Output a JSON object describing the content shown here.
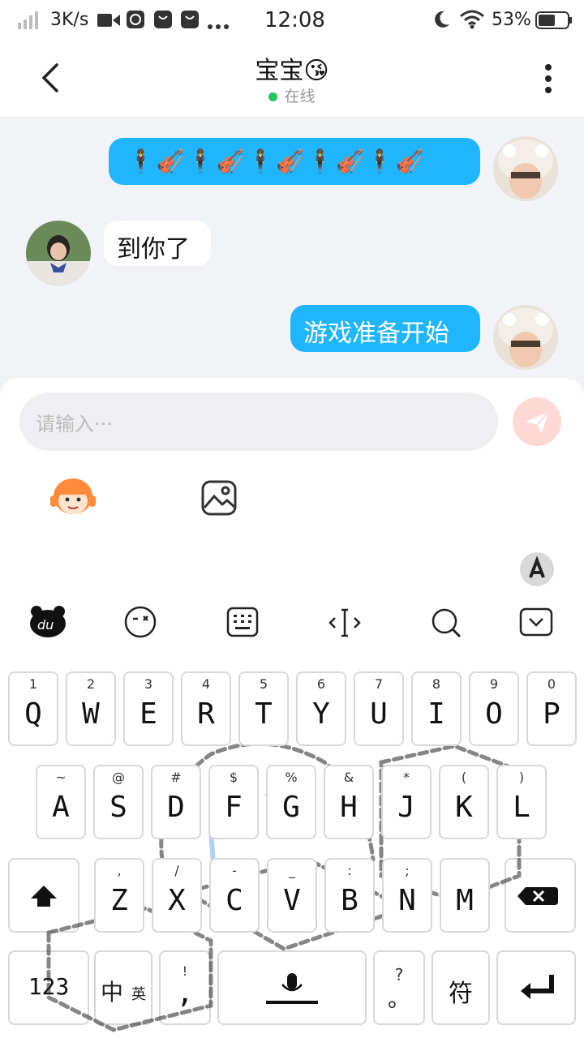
{
  "status_bar": {
    "network_speed": "3K/s",
    "time": "12:08",
    "battery": "53%"
  },
  "header": {
    "title": "宝宝😘",
    "status": "在线"
  },
  "messages": [
    {
      "from": "me",
      "text": "🕴🎻🕴🎻🕴🎻🕴🎻🕴🎻"
    },
    {
      "from": "other",
      "text": "到你了"
    },
    {
      "from": "me",
      "text": "游戏准备开始"
    }
  ],
  "input": {
    "placeholder": "请输入···"
  },
  "keyboard": {
    "row1": [
      {
        "sub": "1",
        "main": "Q"
      },
      {
        "sub": "2",
        "main": "W"
      },
      {
        "sub": "3",
        "main": "E"
      },
      {
        "sub": "4",
        "main": "R"
      },
      {
        "sub": "5",
        "main": "T"
      },
      {
        "sub": "6",
        "main": "Y"
      },
      {
        "sub": "7",
        "main": "U"
      },
      {
        "sub": "8",
        "main": "I"
      },
      {
        "sub": "9",
        "main": "O"
      },
      {
        "sub": "0",
        "main": "P"
      }
    ],
    "row2": [
      {
        "sub": "~",
        "main": "A"
      },
      {
        "sub": "@",
        "main": "S"
      },
      {
        "sub": "#",
        "main": "D"
      },
      {
        "sub": "$",
        "main": "F"
      },
      {
        "sub": "%",
        "main": "G"
      },
      {
        "sub": "&",
        "main": "H"
      },
      {
        "sub": "*",
        "main": "J"
      },
      {
        "sub": "(",
        "main": "K"
      },
      {
        "sub": ")",
        "main": "L"
      }
    ],
    "row3": [
      {
        "sub": ",",
        "main": "Z"
      },
      {
        "sub": "/",
        "main": "X"
      },
      {
        "sub": "-",
        "main": "C"
      },
      {
        "sub": "_",
        "main": "V"
      },
      {
        "sub": ":",
        "main": "B"
      },
      {
        "sub": ";",
        "main": "N"
      },
      {
        "sub": "",
        "main": "M"
      }
    ],
    "num_key": "123",
    "lang_key_main": "中",
    "lang_key_sub": "英",
    "punct_key_sub": "!",
    "punct_key_main": ",",
    "period_key_sub": "?",
    "period_key_main": "。",
    "symbol_key": "符"
  },
  "colors": {
    "bubble_me": "#1fb6ff",
    "online_dot": "#22c55e",
    "send_button": "#ffd9d4"
  }
}
